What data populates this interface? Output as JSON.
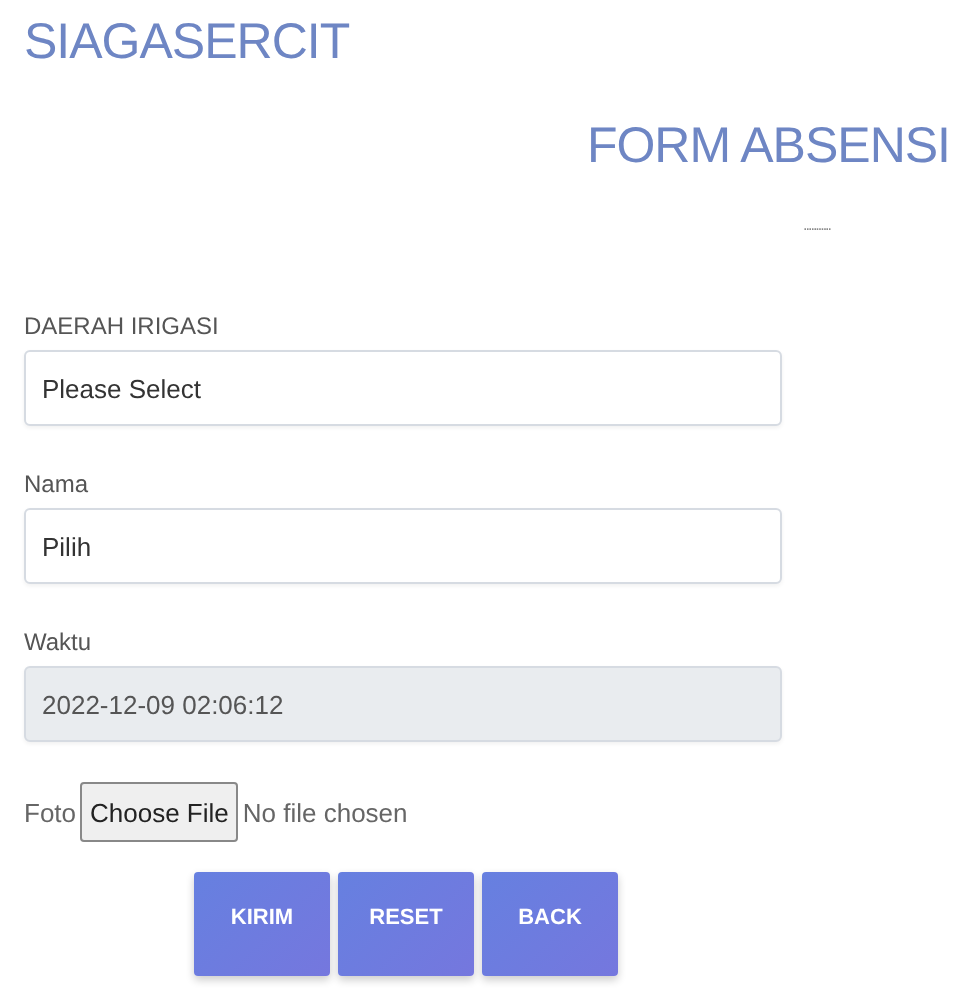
{
  "brand": "SIAGASERCIT",
  "form_title": "FORM ABSENSI",
  "divider_text": "...........",
  "fields": [
    {
      "label": "DAERAH IRIGASI",
      "value": "Please Select",
      "disabled": false
    },
    {
      "label": "Nama",
      "value": "Pilih",
      "disabled": false
    },
    {
      "label": "Waktu",
      "value": "2022-12-09 02:06:12",
      "disabled": true
    }
  ],
  "file_input": {
    "label": "Foto",
    "button": "Choose File",
    "status": "No file chosen"
  },
  "buttons": [
    "KIRIM",
    "RESET",
    "BACK"
  ]
}
